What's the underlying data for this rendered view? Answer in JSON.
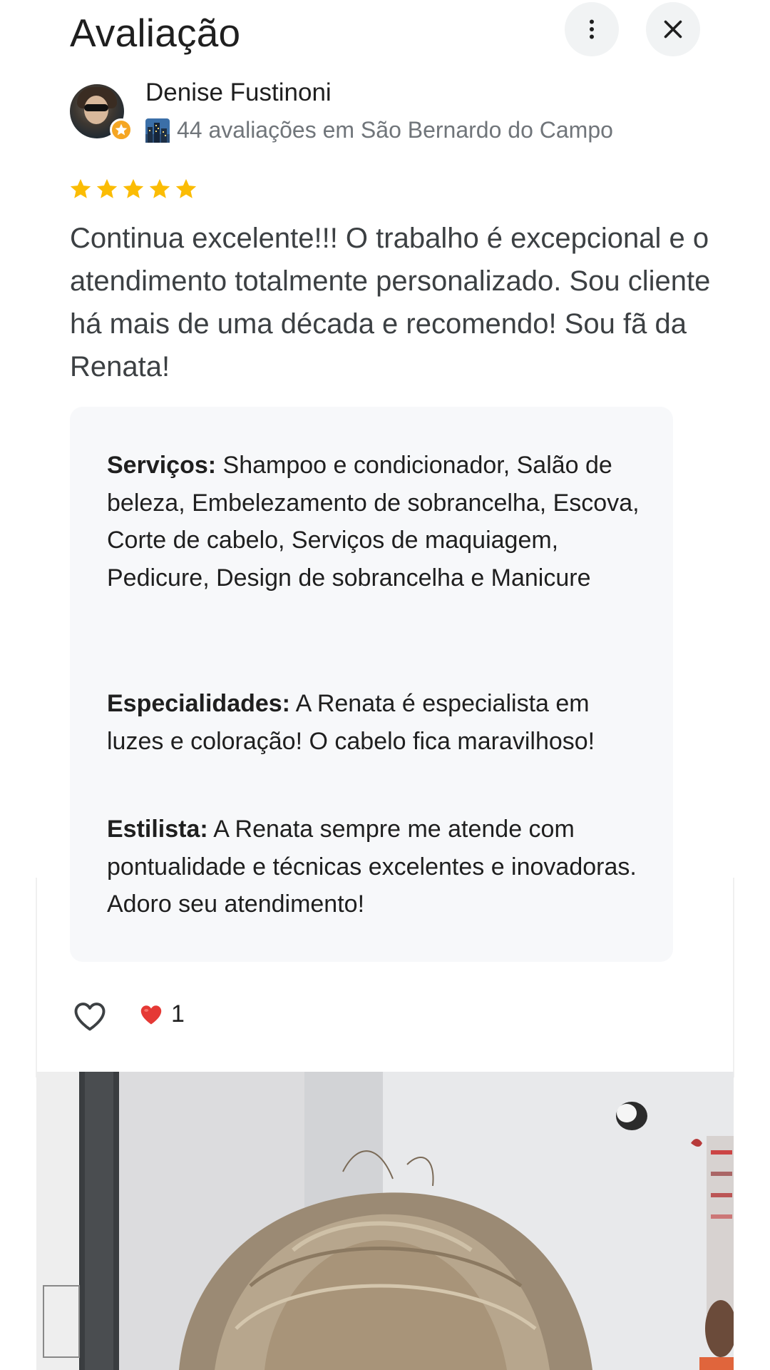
{
  "header": {
    "title": "Avaliação",
    "more_icon": "more-vert-icon",
    "close_icon": "close-icon"
  },
  "author": {
    "name": "Denise Fustinoni",
    "meta": "44 avaliações em São Bernardo do Campo",
    "badge_icon": "local-guide-star-icon",
    "meta_icon": "city-icon"
  },
  "review": {
    "rating": 5,
    "star_color": "#fbbc04",
    "text": "Continua excelente!!! O trabalho é excepcional e o atendimento totalmente personalizado. Sou cliente há mais de uma década e recomendo! Sou fã da Renata!"
  },
  "attributes": [
    {
      "label": "Serviços:",
      "value": " Shampoo e condicionador, Salão de beleza, Embelezamento de sobrancelha, Escova, Corte de cabelo, Serviços de maquiagem, Pedicure, Design de sobrancelha e Manicure"
    },
    {
      "label": "Especialidades:",
      "value": " A Renata é especialista em luzes e coloração! O cabelo fica maravilhoso!"
    },
    {
      "label": "Estilista:",
      "value": " A Renata sempre me atende com pontualidade e técnicas excelentes e inovadoras. Adoro seu atendimento!"
    }
  ],
  "reactions": {
    "like_icon": "heart-outline-icon",
    "reaction_icon": "red-heart-icon",
    "count": "1",
    "heart_color": "#e53935"
  },
  "colors": {
    "badge": "#f5a623",
    "attr_background": "#f7f8fa",
    "secondary_text": "#70757a"
  }
}
